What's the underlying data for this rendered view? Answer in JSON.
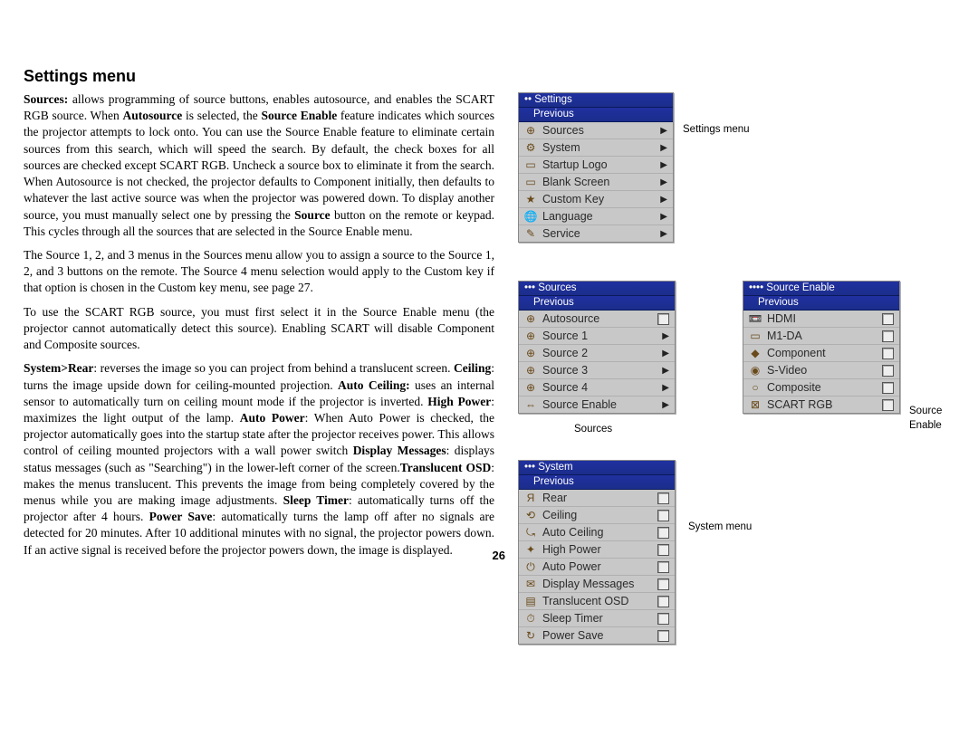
{
  "heading": "Settings menu",
  "body": {
    "p1_a": "Sources:",
    "p1_b": " allows programming of source buttons, enables autosource, and enables the SCART RGB source. When ",
    "p1_c": "Autosource",
    "p1_d": " is selected, the ",
    "p1_e": "Source Enable",
    "p1_f": " feature indicates which sources the projector attempts to lock onto. You can use the Source Enable feature to eliminate certain sources from this search, which will speed the search. By default, the check boxes for all sources are checked except SCART RGB. Uncheck a source box to eliminate it from the search. When Autosource is not checked, the projector defaults to Component initially, then defaults to whatever the last active source was when the projector was powered down. To display another source, you must manually select one by pressing the ",
    "p1_g": "Source",
    "p1_h": " button on the remote or keypad. This cycles through all the sources that are selected in the Source Enable menu.",
    "p2": "The Source 1, 2, and 3 menus in the Sources menu allow you to assign a source to the Source 1, 2, and 3 buttons on the remote. The Source 4 menu selection would apply to the Custom key if that option is chosen in the Custom key menu, see page 27.",
    "p3": "To use the SCART RGB source, you must first select it in the Source Enable menu (the projector cannot automatically detect this source). Enabling SCART will disable Component and Composite sources.",
    "p4_a": "System>Rear",
    "p4_b": ": reverses the image so you can project from behind a translucent screen. ",
    "p4_c": "Ceiling",
    "p4_d": ": turns the image upside down for ceiling-mounted projection. ",
    "p4_e": "Auto Ceiling:",
    "p4_f": " uses an internal sensor to automatically turn on ceiling mount mode if the projector is inverted. ",
    "p4_g": "High Power",
    "p4_h": ": maximizes the light output of the lamp. ",
    "p4_i": "Auto Power",
    "p4_j": ": When Auto Power is checked, the projector automatically goes into the startup state after the projector receives power. This allows control of ceiling mounted projectors with a wall power switch ",
    "p4_k": "Display Messages",
    "p4_l": ": displays status messages (such as \"Searching\") in the lower-left corner of the screen.",
    "p4_m": "Translucent OSD",
    "p4_n": ": makes the menus translucent. This prevents the image from being completely covered by the menus while you are making image adjustments. ",
    "p4_o": "Sleep Timer",
    "p4_p": ": automatically turns off the projector after 4 hours. ",
    "p4_q": "Power Save",
    "p4_r": ": automatically turns the lamp off after no signals are detected for 20 minutes. After 10 additional minutes with no signal, the projector powers down. If an active signal is received before the projector powers down, the image is displayed."
  },
  "pageNumber": "26",
  "menus": {
    "settings": {
      "title": "•• Settings",
      "previous": "Previous",
      "items": [
        {
          "icon": "⊕",
          "label": "Sources",
          "right": "arrow"
        },
        {
          "icon": "⚙",
          "label": "System",
          "right": "arrow"
        },
        {
          "icon": "▭",
          "label": "Startup Logo",
          "right": "arrow"
        },
        {
          "icon": "▭",
          "label": "Blank Screen",
          "right": "arrow"
        },
        {
          "icon": "★",
          "label": "Custom Key",
          "right": "arrow"
        },
        {
          "icon": "🌐",
          "label": "Language",
          "right": "arrow"
        },
        {
          "icon": "✎",
          "label": "Service",
          "right": "arrow"
        }
      ]
    },
    "sources": {
      "title": "••• Sources",
      "previous": "Previous",
      "items": [
        {
          "icon": "⊕",
          "label": "Autosource",
          "right": "check"
        },
        {
          "icon": "⊕",
          "label": "Source 1",
          "right": "arrow"
        },
        {
          "icon": "⊕",
          "label": "Source 2",
          "right": "arrow"
        },
        {
          "icon": "⊕",
          "label": "Source 3",
          "right": "arrow"
        },
        {
          "icon": "⊕",
          "label": "Source 4",
          "right": "arrow"
        },
        {
          "icon": "⇔",
          "label": "Source Enable",
          "right": "arrow"
        }
      ]
    },
    "sourceEnable": {
      "title": "•••• Source Enable",
      "previous": "Previous",
      "items": [
        {
          "icon": "📼",
          "label": "HDMI",
          "right": "check"
        },
        {
          "icon": "▭",
          "label": "M1-DA",
          "right": "check"
        },
        {
          "icon": "◆",
          "label": "Component",
          "right": "check"
        },
        {
          "icon": "◉",
          "label": "S-Video",
          "right": "check"
        },
        {
          "icon": "○",
          "label": "Composite",
          "right": "check"
        },
        {
          "icon": "⊠",
          "label": "SCART RGB",
          "right": "check"
        }
      ]
    },
    "system": {
      "title": "••• System",
      "previous": "Previous",
      "items": [
        {
          "icon": "Я",
          "label": "Rear",
          "right": "check"
        },
        {
          "icon": "⟲",
          "label": "Ceiling",
          "right": "check"
        },
        {
          "icon": "⤿",
          "label": "Auto Ceiling",
          "right": "check"
        },
        {
          "icon": "✦",
          "label": "High Power",
          "right": "check"
        },
        {
          "icon": "⏻",
          "label": "Auto Power",
          "right": "check"
        },
        {
          "icon": "✉",
          "label": "Display Messages",
          "right": "check"
        },
        {
          "icon": "▤",
          "label": "Translucent OSD",
          "right": "check"
        },
        {
          "icon": "⏱",
          "label": "Sleep Timer",
          "right": "check"
        },
        {
          "icon": "↻",
          "label": "Power Save",
          "right": "check"
        }
      ]
    }
  },
  "captions": {
    "settingsMenu": "Settings menu",
    "sources": "Sources",
    "sourceEnable1": "Source",
    "sourceEnable2": "Enable",
    "systemMenu": "System menu"
  }
}
